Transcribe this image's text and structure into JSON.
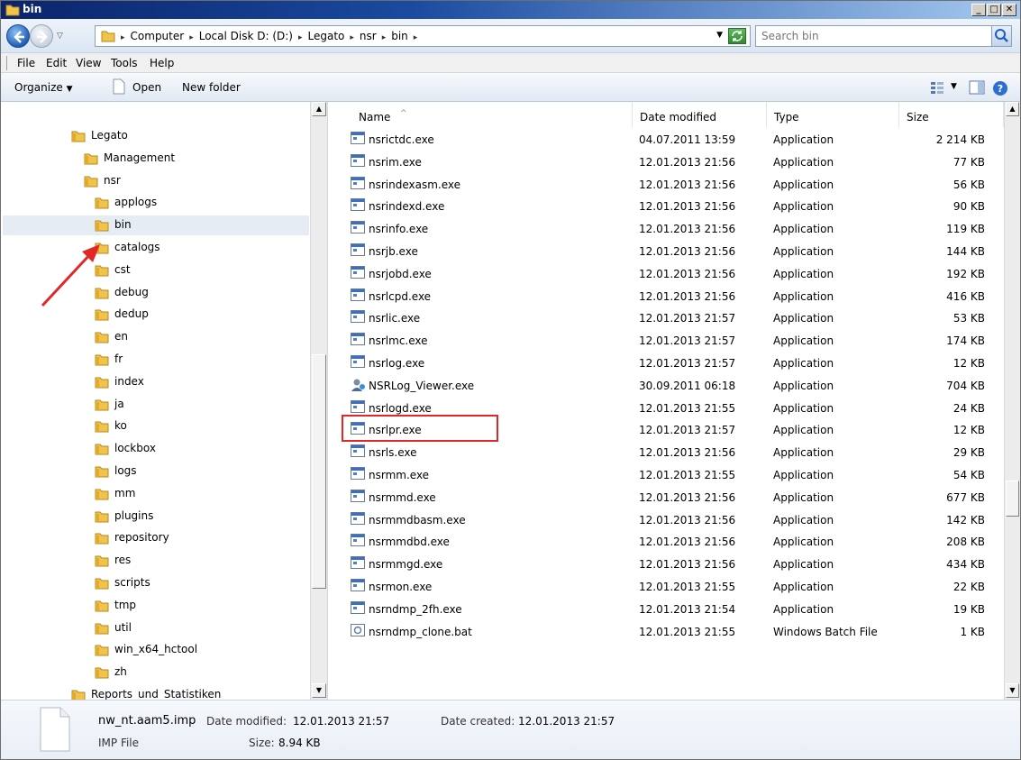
{
  "window": {
    "title": "bin"
  },
  "address": {
    "crumbs": [
      "Computer",
      "Local Disk D: (D:)",
      "Legato",
      "nsr",
      "bin"
    ],
    "search_placeholder": "Search bin"
  },
  "menu": [
    "File",
    "Edit",
    "View",
    "Tools",
    "Help"
  ],
  "toolbar": {
    "organize": "Organize",
    "open": "Open",
    "new_folder": "New folder"
  },
  "tree": [
    {
      "label": "Legato",
      "indent": 0
    },
    {
      "label": "Management",
      "indent": 1
    },
    {
      "label": "nsr",
      "indent": 1
    },
    {
      "label": "applogs",
      "indent": 2
    },
    {
      "label": "bin",
      "indent": 2,
      "selected": true
    },
    {
      "label": "catalogs",
      "indent": 2
    },
    {
      "label": "cst",
      "indent": 2
    },
    {
      "label": "debug",
      "indent": 2
    },
    {
      "label": "dedup",
      "indent": 2
    },
    {
      "label": "en",
      "indent": 2
    },
    {
      "label": "fr",
      "indent": 2
    },
    {
      "label": "index",
      "indent": 2
    },
    {
      "label": "ja",
      "indent": 2
    },
    {
      "label": "ko",
      "indent": 2
    },
    {
      "label": "lockbox",
      "indent": 2
    },
    {
      "label": "logs",
      "indent": 2
    },
    {
      "label": "mm",
      "indent": 2
    },
    {
      "label": "plugins",
      "indent": 2
    },
    {
      "label": "repository",
      "indent": 2
    },
    {
      "label": "res",
      "indent": 2
    },
    {
      "label": "scripts",
      "indent": 2
    },
    {
      "label": "tmp",
      "indent": 2
    },
    {
      "label": "util",
      "indent": 2
    },
    {
      "label": "win_x64_hctool",
      "indent": 2
    },
    {
      "label": "zh",
      "indent": 2
    },
    {
      "label": "Reports_und_Statistiken",
      "indent": 0
    }
  ],
  "columns": {
    "name": "Name",
    "date": "Date modified",
    "type": "Type",
    "size": "Size"
  },
  "files": [
    {
      "name": "nsrictdc.exe",
      "date": "04.07.2011 13:59",
      "type": "Application",
      "size": "2 214 KB"
    },
    {
      "name": "nsrim.exe",
      "date": "12.01.2013 21:56",
      "type": "Application",
      "size": "77 KB"
    },
    {
      "name": "nsrindexasm.exe",
      "date": "12.01.2013 21:56",
      "type": "Application",
      "size": "56 KB"
    },
    {
      "name": "nsrindexd.exe",
      "date": "12.01.2013 21:56",
      "type": "Application",
      "size": "90 KB"
    },
    {
      "name": "nsrinfo.exe",
      "date": "12.01.2013 21:56",
      "type": "Application",
      "size": "119 KB"
    },
    {
      "name": "nsrjb.exe",
      "date": "12.01.2013 21:56",
      "type": "Application",
      "size": "144 KB"
    },
    {
      "name": "nsrjobd.exe",
      "date": "12.01.2013 21:56",
      "type": "Application",
      "size": "192 KB"
    },
    {
      "name": "nsrlcpd.exe",
      "date": "12.01.2013 21:56",
      "type": "Application",
      "size": "416 KB"
    },
    {
      "name": "nsrlic.exe",
      "date": "12.01.2013 21:57",
      "type": "Application",
      "size": "53 KB"
    },
    {
      "name": "nsrlmc.exe",
      "date": "12.01.2013 21:57",
      "type": "Application",
      "size": "174 KB"
    },
    {
      "name": "nsrlog.exe",
      "date": "12.01.2013 21:57",
      "type": "Application",
      "size": "12 KB"
    },
    {
      "name": "NSRLog_Viewer.exe",
      "date": "30.09.2011 06:18",
      "type": "Application",
      "size": "704 KB",
      "special": true
    },
    {
      "name": "nsrlogd.exe",
      "date": "12.01.2013 21:55",
      "type": "Application",
      "size": "24 KB"
    },
    {
      "name": "nsrlpr.exe",
      "date": "12.01.2013 21:57",
      "type": "Application",
      "size": "12 KB"
    },
    {
      "name": "nsrls.exe",
      "date": "12.01.2013 21:56",
      "type": "Application",
      "size": "29 KB"
    },
    {
      "name": "nsrmm.exe",
      "date": "12.01.2013 21:55",
      "type": "Application",
      "size": "54 KB"
    },
    {
      "name": "nsrmmd.exe",
      "date": "12.01.2013 21:56",
      "type": "Application",
      "size": "677 KB"
    },
    {
      "name": "nsrmmdbasm.exe",
      "date": "12.01.2013 21:56",
      "type": "Application",
      "size": "142 KB"
    },
    {
      "name": "nsrmmdbd.exe",
      "date": "12.01.2013 21:56",
      "type": "Application",
      "size": "208 KB"
    },
    {
      "name": "nsrmmgd.exe",
      "date": "12.01.2013 21:56",
      "type": "Application",
      "size": "434 KB"
    },
    {
      "name": "nsrmon.exe",
      "date": "12.01.2013 21:55",
      "type": "Application",
      "size": "22 KB"
    },
    {
      "name": "nsrndmp_2fh.exe",
      "date": "12.01.2013 21:54",
      "type": "Application",
      "size": "19 KB"
    },
    {
      "name": "nsrndmp_clone.bat",
      "date": "12.01.2013 21:55",
      "type": "Windows Batch File",
      "size": "1 KB",
      "batch": true
    }
  ],
  "details": {
    "filename": "nw_nt.aam5.imp",
    "modified_label": "Date modified:",
    "modified": "12.01.2013 21:57",
    "created_label": "Date created:",
    "created": "12.01.2013 21:57",
    "filetype": "IMP File",
    "size_label": "Size:",
    "size": "8.94 KB"
  },
  "colors": {
    "highlight": "#e02828",
    "selection": "#e6ecf3"
  }
}
